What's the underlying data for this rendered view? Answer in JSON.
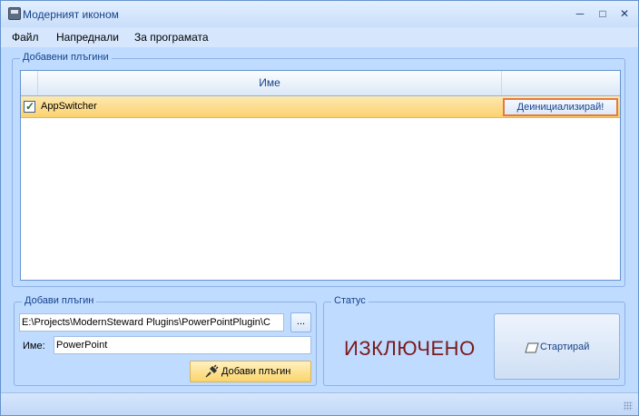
{
  "window": {
    "title": "Модерният иконом",
    "minimize": "─",
    "maximize": "□",
    "close": "✕"
  },
  "menu": [
    "Файл",
    "Напреднали",
    "За програмата"
  ],
  "plugins_group": {
    "label": "Добавени плъгини",
    "column_name": "Име",
    "rows": [
      {
        "checked": true,
        "name": "AppSwitcher",
        "action": "Деинициализирай!"
      }
    ]
  },
  "add_group": {
    "label": "Добави плъгин",
    "path_value": "E:\\Projects\\ModernSteward Plugins\\PowerPointPlugin\\C",
    "browse_label": "...",
    "name_label": "Име:",
    "name_value": "PowerPoint",
    "add_button": "Добави плъгин"
  },
  "status_group": {
    "label": "Статус",
    "status": "ИЗКЛЮЧЕНО",
    "status_color": "#7a1a1a",
    "start_button": "Стартирай"
  },
  "icons": {
    "app": "app-icon",
    "plug": "plug-icon",
    "eraser": "eraser-icon",
    "check": "checkmark-icon",
    "grip": "resize-grip-icon"
  }
}
